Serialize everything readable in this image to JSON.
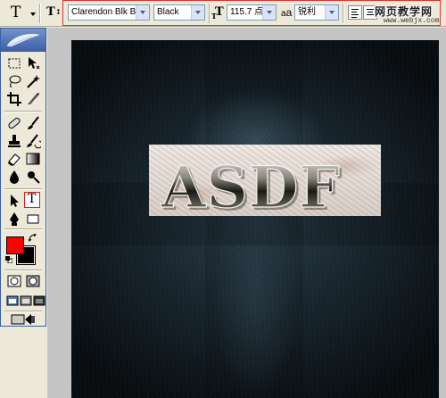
{
  "options_bar": {
    "tool_preset_glyph": "T",
    "font_family": "Clarendon Blk BT",
    "font_style": "Black",
    "font_size": "115.7 点",
    "antialias_label": "a",
    "antialias_label2": "a",
    "antialias": "锐利",
    "align_buttons": [
      "align-left-icon",
      "align-center-icon"
    ]
  },
  "watermark": {
    "line1": "网页教学网",
    "line2": "www.webjx.com"
  },
  "tools": {
    "selected": "type-tool",
    "selected_glyph": "T",
    "foreground_color": "#ff0000",
    "background_color": "#000000",
    "highlight_color": "#d42020"
  },
  "canvas": {
    "text": "ASDF",
    "bg_dark": "#070b0e",
    "bg_light": "#2a3d4a",
    "plate_color": "#e8e0da"
  }
}
